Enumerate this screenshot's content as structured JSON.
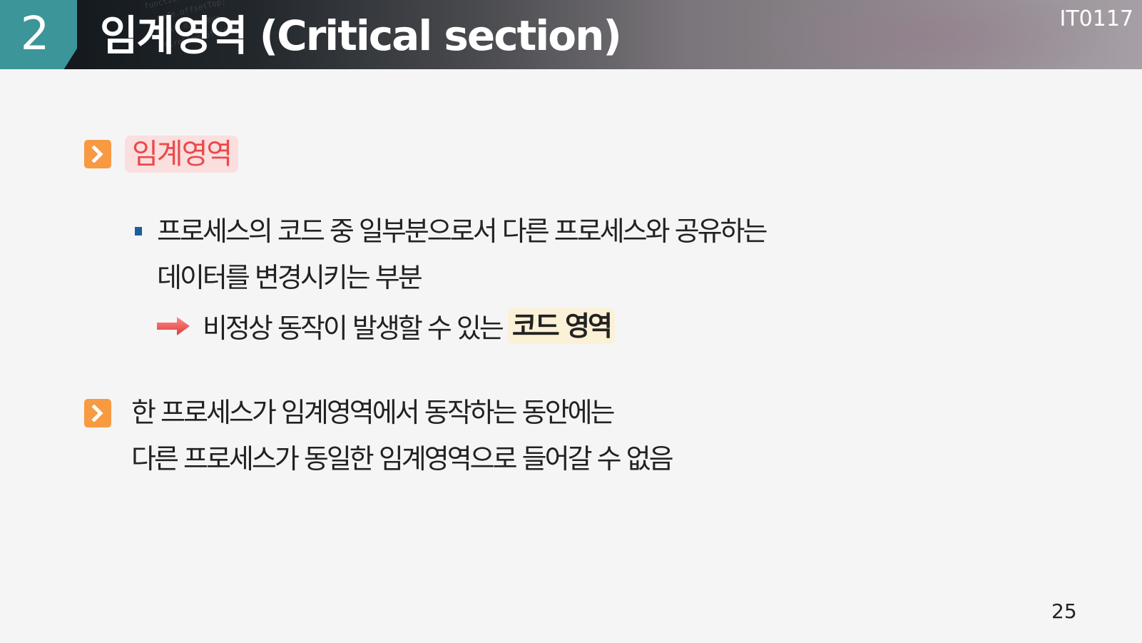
{
  "header": {
    "section_number": "2",
    "title": "임계영역 (Critical section)",
    "course_code": "IT0117"
  },
  "section1": {
    "heading": "임계영역",
    "bullet_line1": "프로세스의 코드 중 일부분으로서 다른 프로세스와 공유하는",
    "bullet_line2": "데이터를 변경시키는 부분",
    "arrow_text": "비정상 동작이 발생할 수 있는",
    "highlight_text": "코드 영역"
  },
  "section2": {
    "line1": "한 프로세스가 임계영역에서 동작하는 동안에는",
    "line2": "다른 프로세스가 동일한 임계영역으로 들어갈 수 없음"
  },
  "footer": {
    "page_number": "25"
  },
  "colors": {
    "teal": "#3b9599",
    "orange": "#f79a42",
    "heading_red": "#ea4a4a",
    "pink_bg": "#fbdede",
    "highlight_bg": "#fbf1d6",
    "arrow_red": "#f05a5a",
    "bullet_blue": "#1c5e9b"
  }
}
